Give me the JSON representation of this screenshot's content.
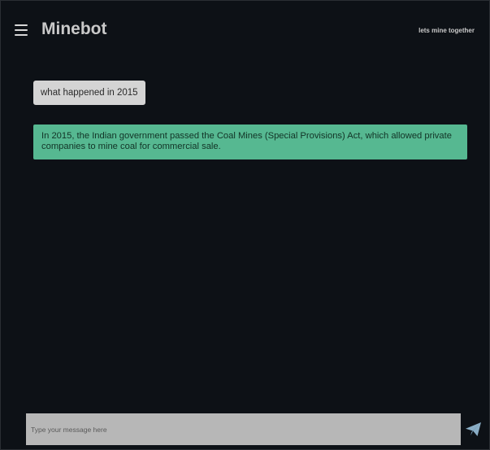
{
  "header": {
    "title": "Minebot",
    "tagline": "lets mine together",
    "menu_icon": "hamburger-menu-icon"
  },
  "chat": {
    "messages": [
      {
        "role": "user",
        "text": "what happened in 2015"
      },
      {
        "role": "bot",
        "text": "In 2015, the Indian government passed the Coal Mines (Special Provisions) Act, which allowed private companies to mine coal for commercial sale."
      }
    ]
  },
  "composer": {
    "placeholder": "Type your message here",
    "value": "",
    "send_icon": "paper-plane-icon"
  },
  "colors": {
    "background": "#0d1116",
    "user_bubble": "#d4d4d4",
    "bot_bubble": "#56b891",
    "input_background": "#b7b7b7",
    "send_icon": "#89adc5",
    "title_text": "#c9c9c9"
  }
}
